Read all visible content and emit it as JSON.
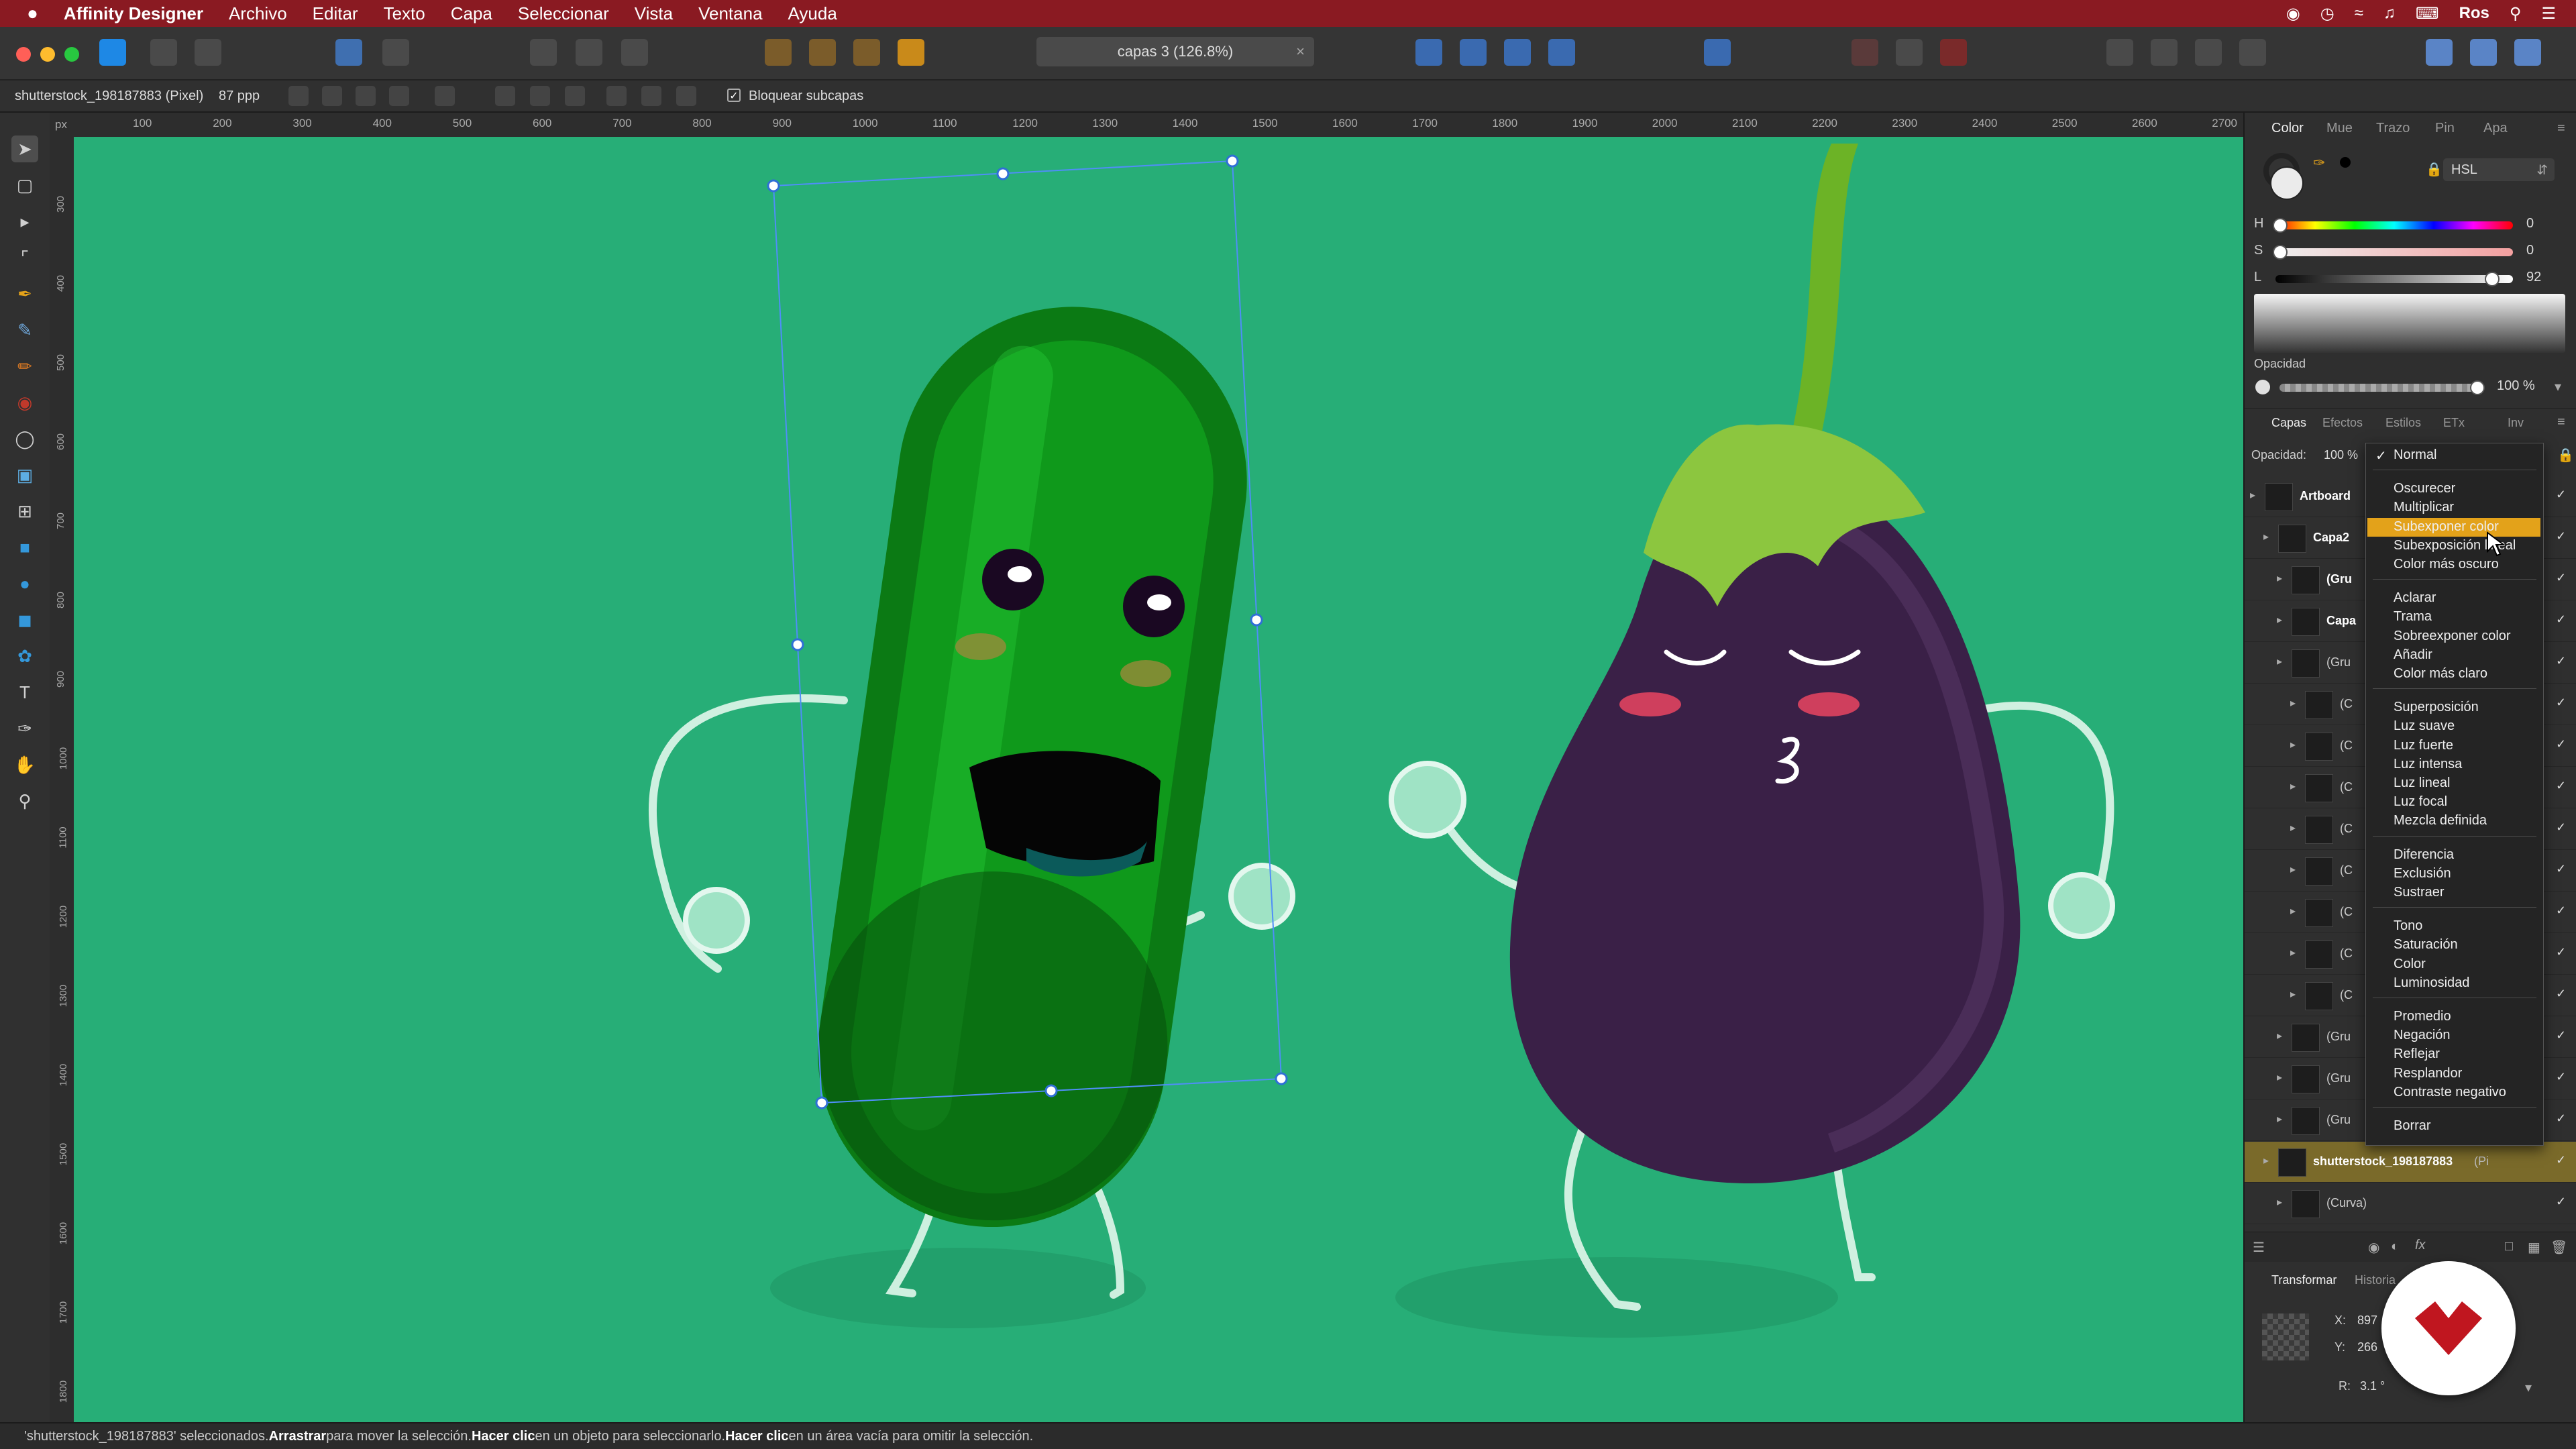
{
  "menubar": {
    "apple": "",
    "app": "Affinity Designer",
    "items": [
      "Archivo",
      "Editar",
      "Texto",
      "Capa",
      "Seleccionar",
      "Vista",
      "Ventana",
      "Ayuda"
    ],
    "user": "Ros"
  },
  "toolbar": {
    "document_title": "capas 3 (126.8%)"
  },
  "context": {
    "selection_name": "shutterstock_198187883 (Pixel)",
    "dpi": "87 ppp",
    "lock_children_label": "Bloquear subcapas"
  },
  "ruler": {
    "unit": "px",
    "h_ticks": [
      "100",
      "200",
      "300",
      "400",
      "500",
      "600",
      "700",
      "800",
      "900",
      "1000",
      "1100",
      "1200",
      "1300",
      "1400",
      "1500",
      "1600",
      "1700",
      "1800",
      "1900",
      "2000",
      "2100",
      "2200",
      "2300",
      "2400",
      "2500",
      "2600",
      "2700"
    ],
    "v_ticks": [
      "300",
      "400",
      "500",
      "600",
      "700",
      "800",
      "900",
      "1000",
      "1100",
      "1200",
      "1300",
      "1400",
      "1500",
      "1600",
      "1700",
      "1800"
    ]
  },
  "color_panel": {
    "tabs": [
      "Color",
      "Mue",
      "Trazo",
      "Pin",
      "Apa"
    ],
    "mode": "HSL",
    "h_label": "H",
    "h_value": "0",
    "s_label": "S",
    "s_value": "0",
    "l_label": "L",
    "l_value": "92",
    "l_level": 0.92,
    "opacity_label": "Opacidad",
    "opacity_value": "100 %"
  },
  "layers_panel": {
    "tabs": [
      "Capas",
      "Efectos",
      "Estilos",
      "ETx",
      "Inv"
    ],
    "opacity_label": "Opacidad:",
    "opacity_value": "100 %",
    "blend_mode": "Normal",
    "rows": [
      {
        "label": "Artboard"
      },
      {
        "label": "Capa2"
      },
      {
        "label": "(Gru"
      },
      {
        "label": "Capa"
      },
      {
        "label": "(Gru"
      },
      {
        "label": "(C"
      },
      {
        "label": "(C"
      },
      {
        "label": "(C"
      },
      {
        "label": "(C"
      },
      {
        "label": "(C"
      },
      {
        "label": "(C"
      },
      {
        "label": "(C"
      },
      {
        "label": "(C"
      },
      {
        "label": "(Gru"
      },
      {
        "label": "(Gru"
      },
      {
        "label": "(Gru"
      },
      {
        "label": "shutterstock_198187883",
        "suffix": "(Pi"
      },
      {
        "label": "(Curva)"
      }
    ]
  },
  "blend_menu": {
    "groups": [
      [
        "Normal"
      ],
      [
        "Oscurecer",
        "Multiplicar",
        "Subexponer color",
        "Subexposición lineal",
        "Color más oscuro"
      ],
      [
        "Aclarar",
        "Trama",
        "Sobreexponer color",
        "Añadir",
        "Color más claro"
      ],
      [
        "Superposición",
        "Luz suave",
        "Luz fuerte",
        "Luz intensa",
        "Luz lineal",
        "Luz focal",
        "Mezcla definida"
      ],
      [
        "Diferencia",
        "Exclusión",
        "Sustraer"
      ],
      [
        "Tono",
        "Saturación",
        "Color",
        "Luminosidad"
      ],
      [
        "Promedio",
        "Negación",
        "Reflejar",
        "Resplandor",
        "Contraste negativo"
      ],
      [
        "Borrar"
      ]
    ],
    "highlighted": "Subexponer color",
    "checked": "Normal"
  },
  "transform_panel": {
    "tabs": [
      "Transformar",
      "Historia"
    ],
    "x_label": "X:",
    "x_value": "897",
    "y_label": "Y:",
    "y_value": "266",
    "r_label": "R:",
    "r_value": "3.1 °"
  },
  "status": {
    "prefix": "'shutterstock_198187883' seleccionados. ",
    "b1": "Arrastrar",
    "t1": " para mover la selección. ",
    "b2": "Hacer clic",
    "t2": " en un objeto para seleccionarlo. ",
    "b3": "Hacer clic",
    "t3": " en un área vacía para omitir la selección."
  },
  "colors": {
    "menubar": "#8a1a22",
    "canvas": "#27ae77",
    "highlight": "#e3a21a",
    "selection_row": "#7a6a2a"
  }
}
